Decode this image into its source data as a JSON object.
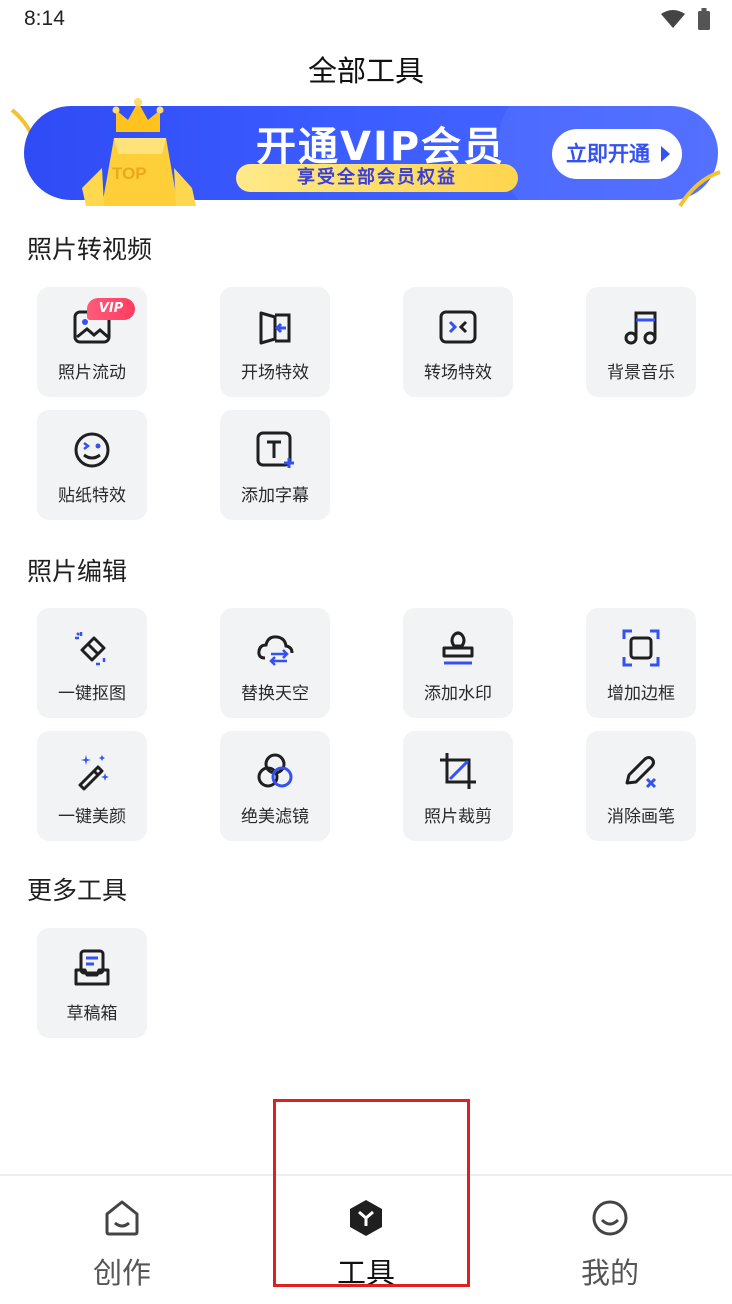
{
  "status": {
    "time": "8:14"
  },
  "header": {
    "title": "全部工具"
  },
  "banner": {
    "badge_text": "TOP",
    "headline": "开通VIP会员",
    "subline": "享受全部会员权益",
    "button_label": "立即开通"
  },
  "sections": [
    {
      "title": "照片转视频",
      "tools": [
        {
          "label": "照片流动",
          "icon": "photo-flow-icon",
          "badge": "VIP"
        },
        {
          "label": "开场特效",
          "icon": "opening-effect-icon"
        },
        {
          "label": "转场特效",
          "icon": "transition-effect-icon"
        },
        {
          "label": "背景音乐",
          "icon": "music-note-icon"
        },
        {
          "label": "贴纸特效",
          "icon": "sticker-face-icon"
        },
        {
          "label": "添加字幕",
          "icon": "add-text-icon"
        }
      ]
    },
    {
      "title": "照片编辑",
      "tools": [
        {
          "label": "一键抠图",
          "icon": "cutout-eraser-icon"
        },
        {
          "label": "替换天空",
          "icon": "sky-replace-icon"
        },
        {
          "label": "添加水印",
          "icon": "watermark-stamp-icon"
        },
        {
          "label": "增加边框",
          "icon": "frame-border-icon"
        },
        {
          "label": "一键美颜",
          "icon": "magic-wand-icon"
        },
        {
          "label": "绝美滤镜",
          "icon": "filter-circles-icon"
        },
        {
          "label": "照片裁剪",
          "icon": "crop-icon"
        },
        {
          "label": "消除画笔",
          "icon": "erase-brush-icon"
        }
      ]
    },
    {
      "title": "更多工具",
      "tools": [
        {
          "label": "草稿箱",
          "icon": "drafts-box-icon"
        }
      ]
    }
  ],
  "nav": {
    "items": [
      {
        "label": "创作",
        "icon": "create-home-icon"
      },
      {
        "label": "工具",
        "icon": "tools-cube-icon",
        "active": true
      },
      {
        "label": "我的",
        "icon": "profile-smile-icon"
      }
    ]
  },
  "colors": {
    "accent": "#3552f0",
    "banner_blue": "#3b5cff",
    "vip_pink": "#ff3d60",
    "gold": "#ffd54d",
    "highlight_red": "#e02020"
  }
}
